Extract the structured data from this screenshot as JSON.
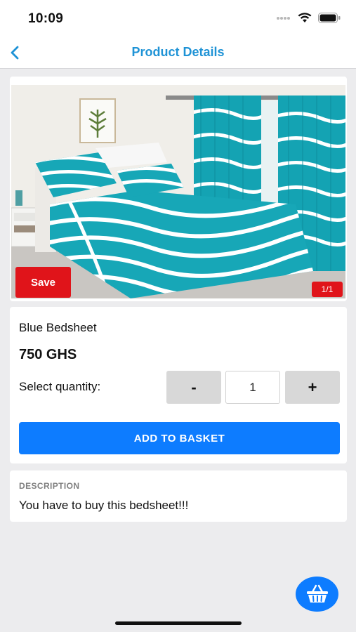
{
  "status_bar": {
    "time": "10:09",
    "icons": [
      "signal-dots-icon",
      "wifi-icon",
      "battery-icon"
    ]
  },
  "nav": {
    "back_icon": "chevron-left-icon",
    "title": "Product Details"
  },
  "colors": {
    "accent": "#1f93d6",
    "primary_button": "#0d7cff",
    "save_red": "#e0141a",
    "background": "#ececee"
  },
  "gallery": {
    "save_label": "Save",
    "page_indicator": "1/1",
    "image": "bedroom-bedsheet-photo"
  },
  "product": {
    "name": "Blue Bedsheet",
    "price": "750 GHS",
    "quantity_label": "Select quantity:",
    "decrement_label": "-",
    "quantity": "1",
    "increment_label": "+",
    "add_to_basket_label": "ADD TO BASKET"
  },
  "description": {
    "heading": "DESCRIPTION",
    "text": "You have to buy this bedsheet!!!"
  },
  "fab": {
    "icon": "basket-icon"
  }
}
